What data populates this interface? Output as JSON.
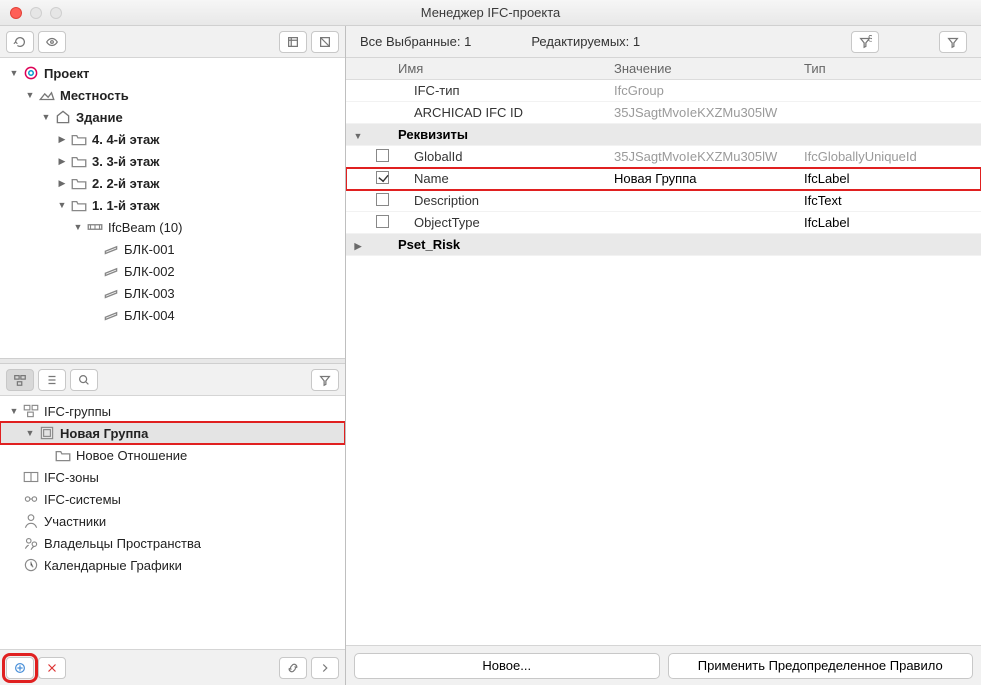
{
  "window": {
    "title": "Менеджер IFC-проекта"
  },
  "status": {
    "selected_label": "Все Выбранные: 1",
    "editable_label": "Редактируемых: 1"
  },
  "toolbar_icons": {
    "refresh": "↻",
    "eye": "👁",
    "sel1": "⬚",
    "sel2": "⬚",
    "filter1": "⚙",
    "filter2": "⚙"
  },
  "tree_top": [
    {
      "indent": 0,
      "exp": "down",
      "icon": "project",
      "label": "Проект",
      "bold": true
    },
    {
      "indent": 1,
      "exp": "down",
      "icon": "site",
      "label": "Местность",
      "bold": true
    },
    {
      "indent": 2,
      "exp": "down",
      "icon": "building",
      "label": "Здание",
      "bold": true
    },
    {
      "indent": 3,
      "exp": "right",
      "icon": "folder",
      "label": "4. 4-й этаж",
      "bold": true
    },
    {
      "indent": 3,
      "exp": "right",
      "icon": "folder",
      "label": "3. 3-й этаж",
      "bold": true
    },
    {
      "indent": 3,
      "exp": "right",
      "icon": "folder",
      "label": "2. 2-й этаж",
      "bold": true
    },
    {
      "indent": 3,
      "exp": "down",
      "icon": "folder",
      "label": "1. 1-й этаж",
      "bold": true
    },
    {
      "indent": 4,
      "exp": "down",
      "icon": "beamgrp",
      "label": "IfcBeam (10)",
      "bold": false
    },
    {
      "indent": 5,
      "exp": "",
      "icon": "beam",
      "label": "БЛК-001",
      "bold": false
    },
    {
      "indent": 5,
      "exp": "",
      "icon": "beam",
      "label": "БЛК-002",
      "bold": false
    },
    {
      "indent": 5,
      "exp": "",
      "icon": "beam",
      "label": "БЛК-003",
      "bold": false
    },
    {
      "indent": 5,
      "exp": "",
      "icon": "beam",
      "label": "БЛК-004",
      "bold": false
    }
  ],
  "tree_bottom": [
    {
      "indent": 0,
      "exp": "down",
      "icon": "groups",
      "label": "IFC-группы",
      "bold": false
    },
    {
      "indent": 1,
      "exp": "down",
      "icon": "group",
      "label": "Новая Группа",
      "bold": true,
      "sel": true,
      "hl": true
    },
    {
      "indent": 2,
      "exp": "",
      "icon": "folder",
      "label": "Новое Отношение",
      "bold": false
    },
    {
      "indent": 0,
      "exp": "",
      "icon": "zones",
      "label": "IFC-зоны",
      "bold": false
    },
    {
      "indent": 0,
      "exp": "",
      "icon": "systems",
      "label": "IFC-системы",
      "bold": false
    },
    {
      "indent": 0,
      "exp": "",
      "icon": "actors",
      "label": "Участники",
      "bold": false
    },
    {
      "indent": 0,
      "exp": "",
      "icon": "owners",
      "label": "Владельцы Пространства",
      "bold": false
    },
    {
      "indent": 0,
      "exp": "",
      "icon": "schedule",
      "label": "Календарные Графики",
      "bold": false
    }
  ],
  "props": {
    "headers": {
      "name": "Имя",
      "value": "Значение",
      "type": "Тип"
    },
    "top": [
      {
        "name": "IFC-тип",
        "value": "IfcGroup",
        "type": "",
        "gray": true
      },
      {
        "name": "ARCHICAD IFC ID",
        "value": "35JSagtMvoIeKXZMu305lW",
        "type": "",
        "gray": true
      }
    ],
    "group1": "Реквизиты",
    "attrs": [
      {
        "check": false,
        "name": "GlobalId",
        "value": "35JSagtMvoIeKXZMu305lW",
        "type": "IfcGloballyUniqueId",
        "gray": true
      },
      {
        "check": true,
        "name": "Name",
        "value": "Новая Группа",
        "type": "IfcLabel",
        "hl": true
      },
      {
        "check": false,
        "name": "Description",
        "value": "",
        "type": "IfcText"
      },
      {
        "check": false,
        "name": "ObjectType",
        "value": "",
        "type": "IfcLabel"
      }
    ],
    "group2": "Pset_Risk"
  },
  "footer": {
    "new_btn": "Новое...",
    "apply_btn": "Применить Предопределенное Правило"
  }
}
